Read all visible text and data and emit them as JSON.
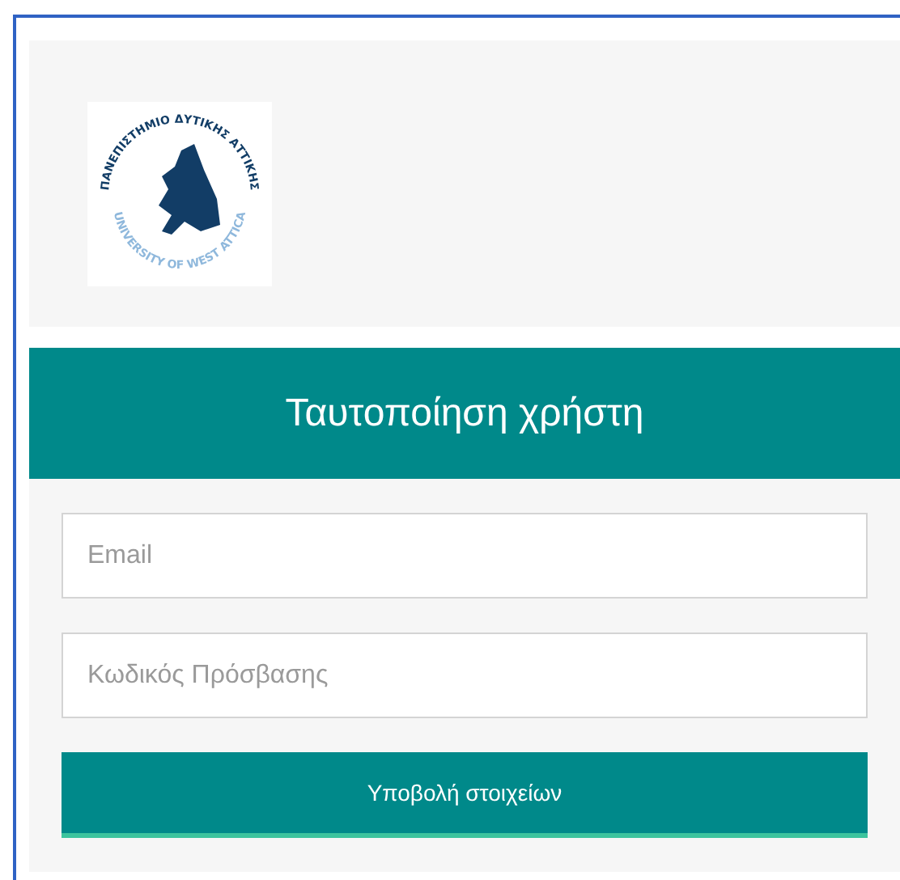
{
  "logo": {
    "top_text": "ΠΑΝΕΠΙΣΤΗΜΙΟ ΔΥΤΙΚΗΣ ΑΤΤΙΚΗΣ",
    "bottom_text": "UNIVERSITY OF WEST ATTICA"
  },
  "login": {
    "title": "Ταυτοποίηση χρήστη",
    "fields": [
      {
        "placeholder": "Email"
      },
      {
        "placeholder": "Κωδικός Πρόσβασης"
      }
    ],
    "submit": "Υποβολή στοιχείων"
  }
}
